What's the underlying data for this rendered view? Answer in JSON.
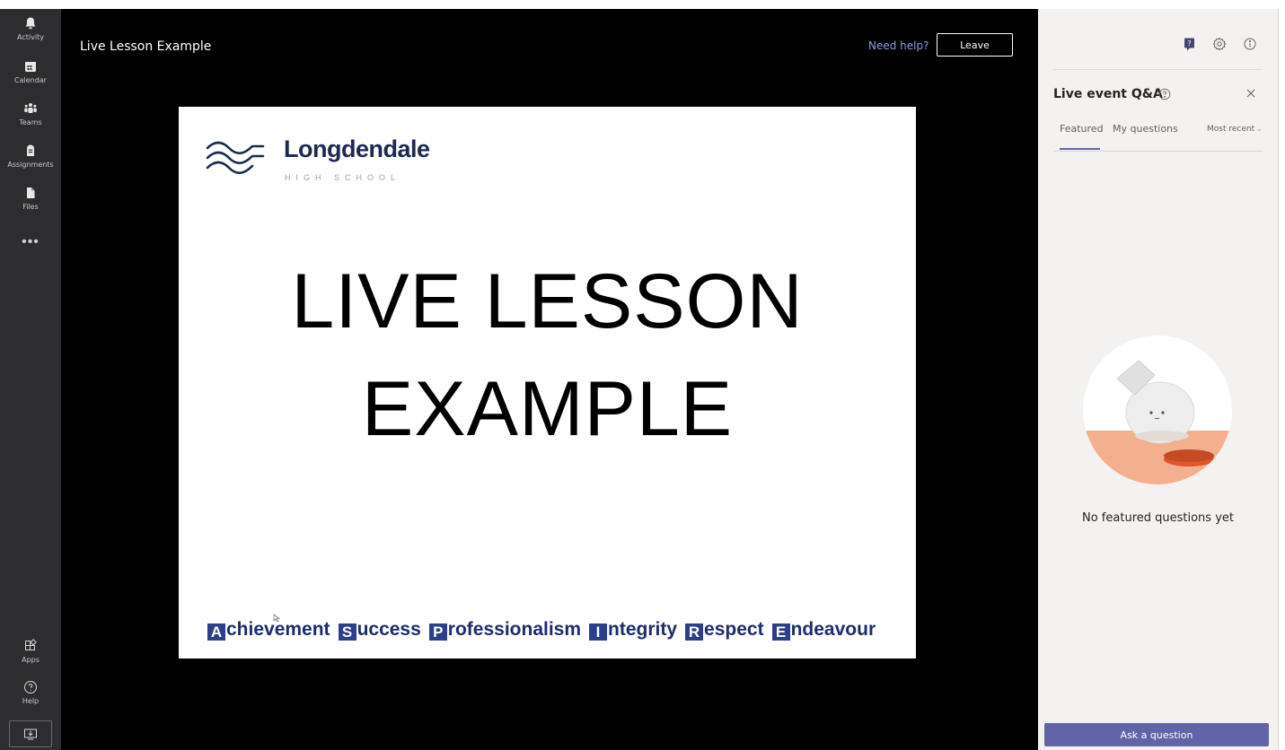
{
  "rail": {
    "items": [
      {
        "label": "Activity",
        "icon": "bell-icon"
      },
      {
        "label": "Calendar",
        "icon": "calendar-icon"
      },
      {
        "label": "Teams",
        "icon": "teams-icon"
      },
      {
        "label": "Assignments",
        "icon": "assignments-icon"
      },
      {
        "label": "Files",
        "icon": "files-icon"
      }
    ],
    "more_label": "•••",
    "apps_label": "Apps",
    "help_label": "Help",
    "download_icon": "download-app-icon"
  },
  "header": {
    "title": "Live Lesson Example",
    "need_help": "Need help?",
    "leave_label": "Leave"
  },
  "slide": {
    "brand_name": "Longdendale",
    "brand_sub": "HIGH SCHOOL",
    "lines": [
      "LIVE LESSON",
      "EXAMPLE"
    ],
    "values": [
      {
        "cap": "A",
        "rest": "chievement"
      },
      {
        "cap": "S",
        "rest": "uccess"
      },
      {
        "cap": "P",
        "rest": "rofessionalism"
      },
      {
        "cap": "I",
        "rest": "ntegrity"
      },
      {
        "cap": "R",
        "rest": "espect"
      },
      {
        "cap": "E",
        "rest": "ndeavour"
      }
    ]
  },
  "qa": {
    "title": "Live event Q&A",
    "tabs": [
      "Featured",
      "My questions"
    ],
    "active_tab": "Featured",
    "sort_label": "Most recent",
    "empty_text": "No featured questions yet",
    "ask_label": "Ask a question",
    "accent": "#6264a7"
  }
}
